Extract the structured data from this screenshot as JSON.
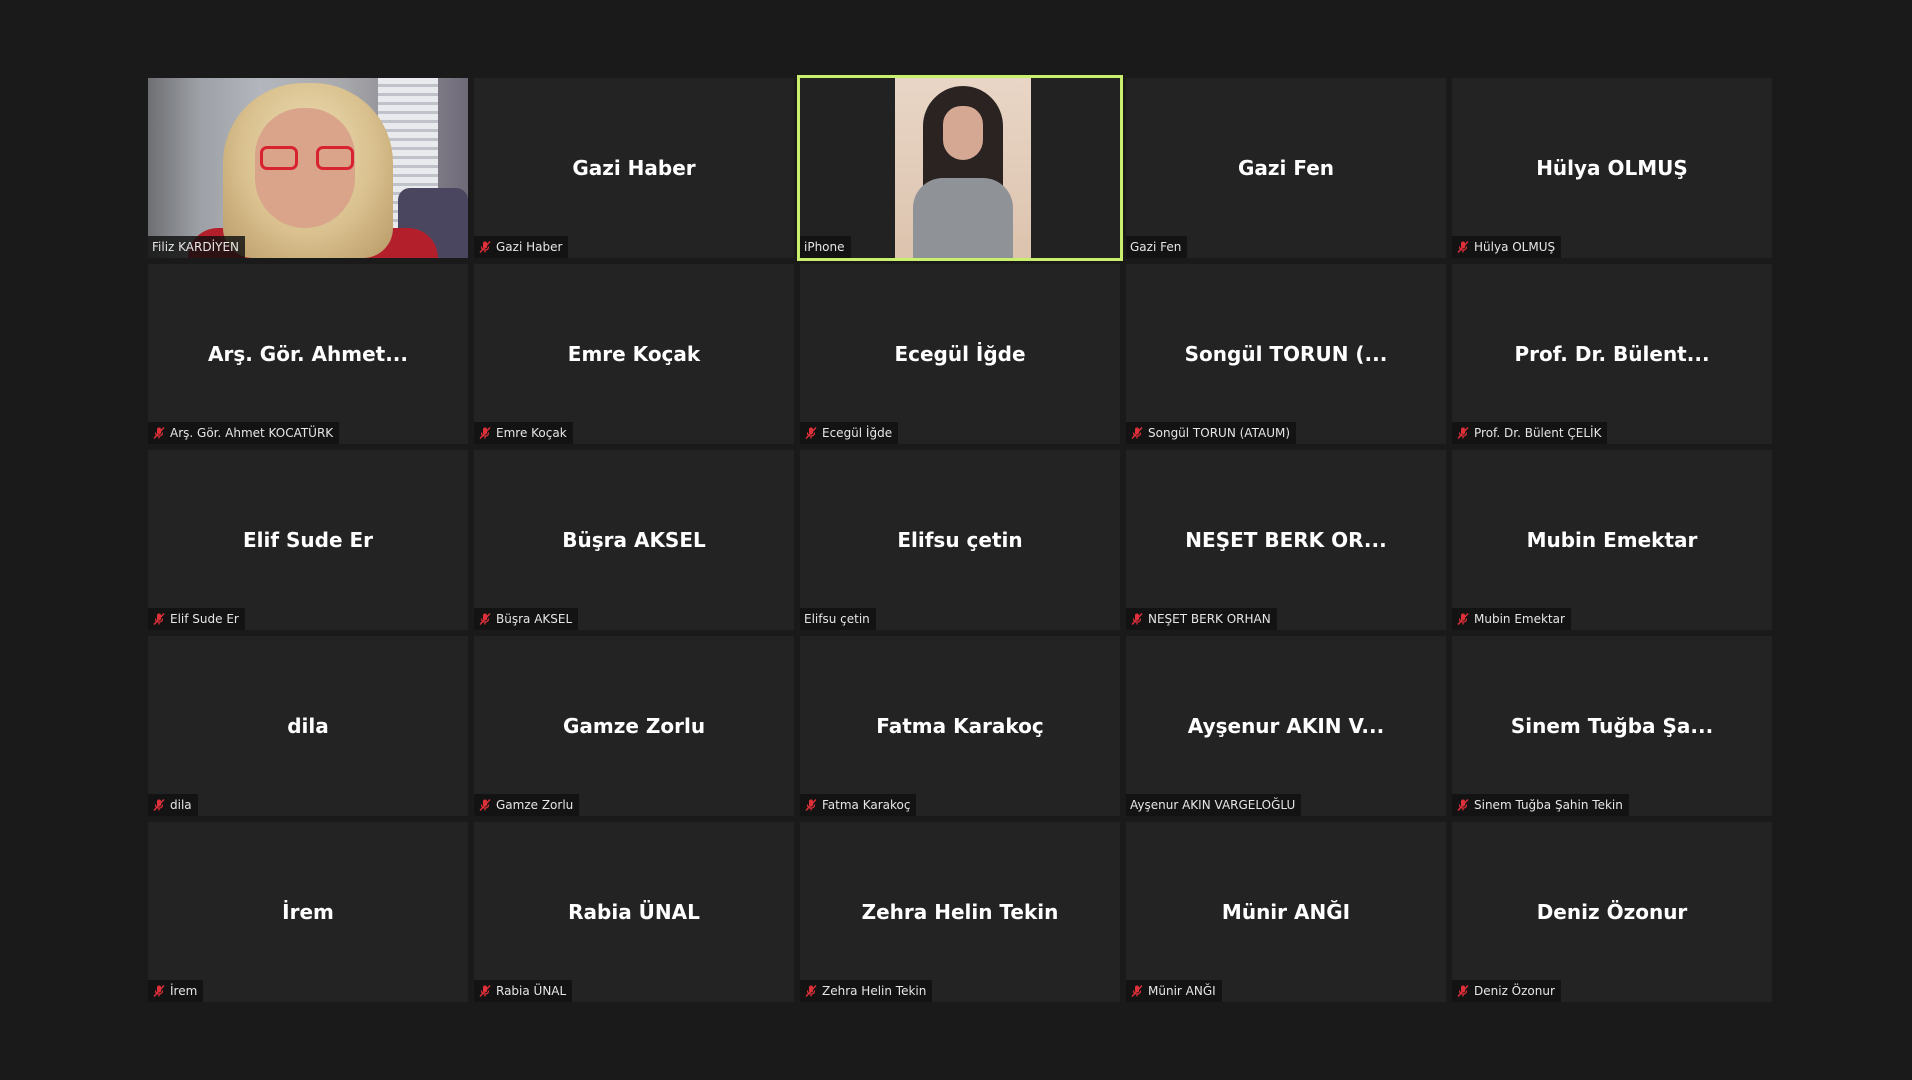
{
  "colors": {
    "background": "#1a1a1a",
    "tile": "#232323",
    "active_speaker_border": "#c8ef6d",
    "muted_icon": "#e0303a"
  },
  "participants": [
    {
      "display": "",
      "label": "Filiz KARDİYEN",
      "muted": false,
      "video": "filiz",
      "active": false
    },
    {
      "display": "Gazi Haber",
      "label": "Gazi Haber",
      "muted": true,
      "video": null,
      "active": false
    },
    {
      "display": "",
      "label": "iPhone",
      "muted": false,
      "video": "iphone",
      "active": true
    },
    {
      "display": "Gazi Fen",
      "label": "Gazi Fen",
      "muted": false,
      "video": null,
      "active": false
    },
    {
      "display": "Hülya OLMUŞ",
      "label": "Hülya OLMUŞ",
      "muted": true,
      "video": null,
      "active": false
    },
    {
      "display": "Arş. Gör. Ahmet...",
      "label": "Arş. Gör. Ahmet KOCATÜRK",
      "muted": true,
      "video": null,
      "active": false
    },
    {
      "display": "Emre Koçak",
      "label": "Emre Koçak",
      "muted": true,
      "video": null,
      "active": false
    },
    {
      "display": "Ecegül İğde",
      "label": "Ecegül İğde",
      "muted": true,
      "video": null,
      "active": false
    },
    {
      "display": "Songül TORUN (...",
      "label": "Songül TORUN (ATAUM)",
      "muted": true,
      "video": null,
      "active": false
    },
    {
      "display": "Prof. Dr. Bülent...",
      "label": "Prof. Dr. Bülent ÇELİK",
      "muted": true,
      "video": null,
      "active": false
    },
    {
      "display": "Elif Sude Er",
      "label": "Elif Sude Er",
      "muted": true,
      "video": null,
      "active": false
    },
    {
      "display": "Büşra AKSEL",
      "label": "Büşra AKSEL",
      "muted": true,
      "video": null,
      "active": false
    },
    {
      "display": "Elifsu çetin",
      "label": "Elifsu çetin",
      "muted": false,
      "video": null,
      "active": false
    },
    {
      "display": "NEŞET BERK OR...",
      "label": "NEŞET BERK ORHAN",
      "muted": true,
      "video": null,
      "active": false
    },
    {
      "display": "Mubin Emektar",
      "label": "Mubin Emektar",
      "muted": true,
      "video": null,
      "active": false
    },
    {
      "display": "dila",
      "label": "dila",
      "muted": true,
      "video": null,
      "active": false
    },
    {
      "display": "Gamze Zorlu",
      "label": "Gamze Zorlu",
      "muted": true,
      "video": null,
      "active": false
    },
    {
      "display": "Fatma Karakoç",
      "label": "Fatma Karakoç",
      "muted": true,
      "video": null,
      "active": false
    },
    {
      "display": "Ayşenur AKIN V...",
      "label": "Ayşenur AKIN VARGELOĞLU",
      "muted": false,
      "video": null,
      "active": false
    },
    {
      "display": "Sinem Tuğba Şa...",
      "label": "Sinem Tuğba Şahin Tekin",
      "muted": true,
      "video": null,
      "active": false
    },
    {
      "display": "İrem",
      "label": "İrem",
      "muted": true,
      "video": null,
      "active": false
    },
    {
      "display": "Rabia ÜNAL",
      "label": "Rabia ÜNAL",
      "muted": true,
      "video": null,
      "active": false
    },
    {
      "display": "Zehra Helin Tekin",
      "label": "Zehra Helin Tekin",
      "muted": true,
      "video": null,
      "active": false
    },
    {
      "display": "Münir ANĞI",
      "label": "Münir ANĞI",
      "muted": true,
      "video": null,
      "active": false
    },
    {
      "display": "Deniz Özonur",
      "label": "Deniz Özonur",
      "muted": true,
      "video": null,
      "active": false
    }
  ]
}
